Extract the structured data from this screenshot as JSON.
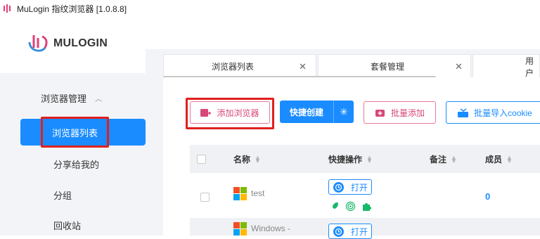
{
  "window": {
    "title": "MuLogin 指纹浏览器 [1.0.8.8]"
  },
  "logo": {
    "text": "MULOGIN"
  },
  "sidebar": {
    "group_label": "浏览器管理",
    "active_item": "浏览器列表",
    "items": [
      {
        "label": "分享给我的"
      },
      {
        "label": "分组"
      },
      {
        "label": "回收站"
      }
    ]
  },
  "tabs": [
    {
      "label": "浏览器列表"
    },
    {
      "label": "套餐管理"
    },
    {
      "label": "用户"
    }
  ],
  "toolbar": {
    "add_label": "添加浏览器",
    "quick_label": "快捷创建",
    "batch_label": "批量添加",
    "cookie_label": "批量导入cookie"
  },
  "table": {
    "headers": {
      "name": "名称",
      "actions": "快捷操作",
      "notes": "备注",
      "members": "成员"
    },
    "rows": [
      {
        "name": "test",
        "open": "打开",
        "members": "0"
      },
      {
        "name": "Windows -",
        "open": "打开"
      }
    ]
  },
  "colors": {
    "primary": "#1a8cff",
    "pink": "#d8477a",
    "highlight": "#e0201e",
    "success": "#18b86b"
  }
}
